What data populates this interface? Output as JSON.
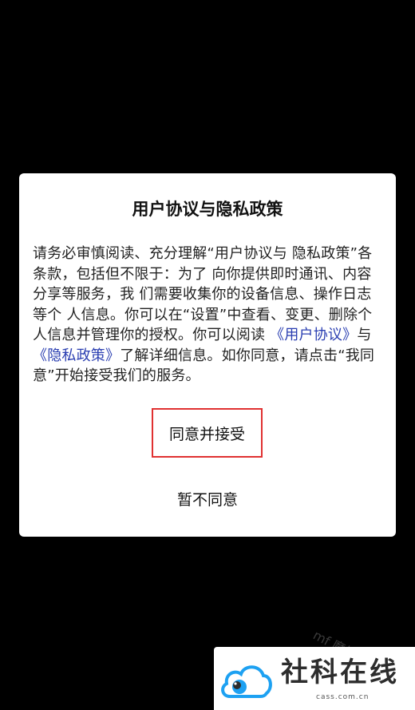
{
  "dialog": {
    "title": "用户协议与隐私政策",
    "body": {
      "part1": "  请务必审慎阅读、充分理解“用户协议与 隐私政策”各条款，包括但不限于：为了 向你提供即时通讯、内容分享等服务，我 们需要收集你的设备信息、操作日志等个 人信息。你可以在“设置”中查看、变更、删除个人信息并管理你的授权。你可以阅读 ",
      "link1": "《用户协议》",
      "part2": "与 ",
      "link2": "《隐私政策》",
      "part3": "了解详细信息。如你同意，请点击“我同意”开始接受我们的服务。"
    },
    "accept_label": "同意并接受",
    "decline_label": "暂不同意"
  },
  "watermark": {
    "faint_text": "mf 魔扣",
    "title": "社科在线",
    "url": "cass.com.cn"
  },
  "colors": {
    "background": "#000000",
    "dialog": "#ffffff",
    "link": "#2a3eb1",
    "highlight_border": "#e03131",
    "logo_blue": "#1da1f2"
  }
}
